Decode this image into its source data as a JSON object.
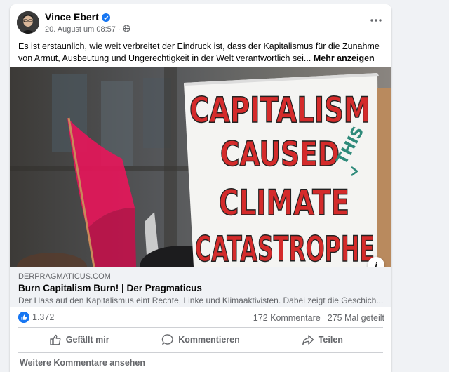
{
  "post": {
    "author": "Vince Ebert",
    "date": "20. August um 08:57",
    "text": "Es ist erstaunlich, wie weit verbreitet der Eindruck ist, dass der Kapitalismus für die Zunahme von Armut, Ausbeutung und Ungerechtigkeit in der Welt verantwortlich sei...",
    "see_more": "Mehr anzeigen",
    "more_icon": "more-horizontal-icon",
    "audience_icon": "globe-icon"
  },
  "image": {
    "sign_lines": [
      "CAPITALISM",
      "CAUSED",
      "CLIMATE",
      "CATASTROPHE"
    ],
    "sign_insert": "THIS",
    "info_icon": "i"
  },
  "link": {
    "domain": "DERPRAGMATICUS.COM",
    "title": "Burn Capitalism Burn! | Der Pragmaticus",
    "description": "Der Hass auf den Kapitalismus eint Rechte, Linke und Klimaaktivisten. Dabei zeigt die Geschich..."
  },
  "stats": {
    "reactions": "1.372",
    "comments": "172 Kommentare",
    "shares": "275 Mal geteilt"
  },
  "actions": {
    "like": "Gefällt mir",
    "comment": "Kommentieren",
    "share": "Teilen"
  },
  "more_comments": "Weitere Kommentare ansehen",
  "colors": {
    "accent": "#1877f2",
    "secondary_text": "#65676b",
    "sign_text": "#d42b2b",
    "flag": "#e8155a"
  }
}
